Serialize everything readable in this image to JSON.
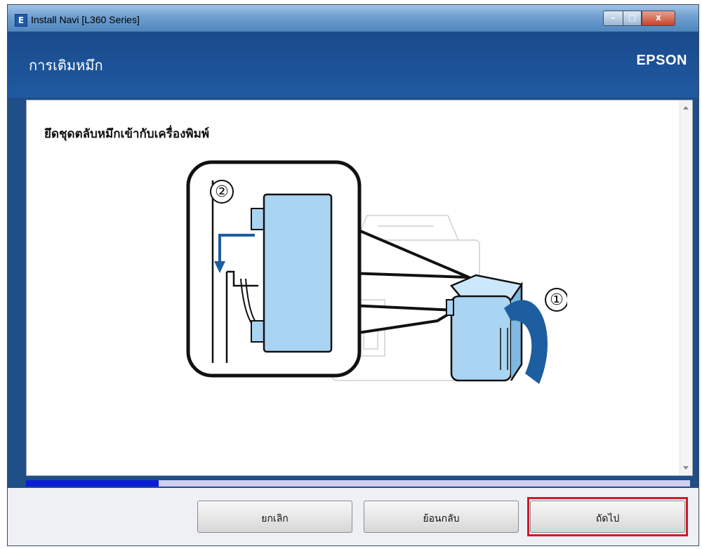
{
  "window": {
    "title": "Install Navi [L360 Series]",
    "icon": "E",
    "controls": {
      "minimize": "–",
      "maximize": "□",
      "close": "x"
    }
  },
  "header": {
    "title": "การเติมหมึก",
    "brand": "EPSON"
  },
  "content": {
    "instruction": "ยึดชุดตลับหมึกเข้ากับเครื่องพิมพ์",
    "step_markers": [
      "②",
      "①"
    ]
  },
  "progress": {
    "value": 0.2
  },
  "footer": {
    "cancel_label": "ยกเลิก",
    "back_label": "ย้อนกลับ",
    "next_label": "ถัดไป"
  },
  "colors": {
    "header_bg": "#1f5aa0",
    "progress_fill": "#0a1ed8",
    "progress_track": "#cfcff2",
    "highlight_box": "#d0182a",
    "ink_tank": "#a9d4f2",
    "arrow_blue": "#1d5ea0"
  }
}
